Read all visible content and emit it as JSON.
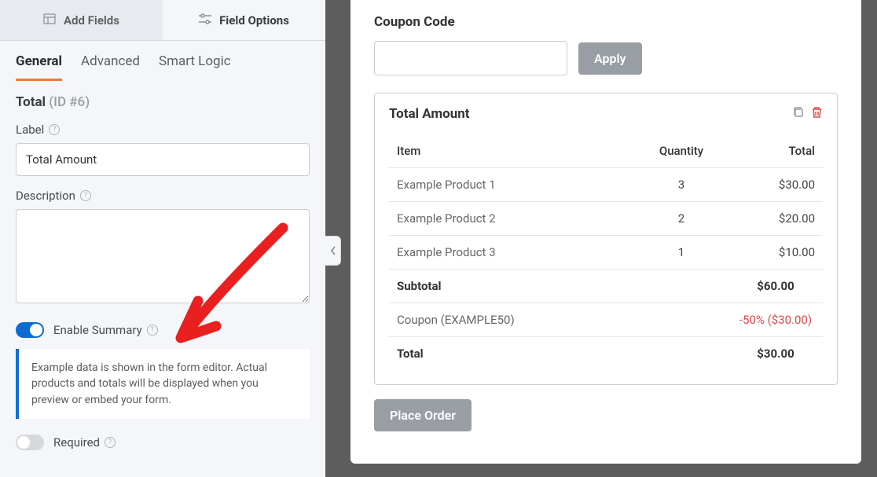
{
  "top_tabs": {
    "add_fields": "Add Fields",
    "field_options": "Field Options"
  },
  "sub_tabs": {
    "general": "General",
    "advanced": "Advanced",
    "smart_logic": "Smart Logic"
  },
  "field": {
    "name": "Total",
    "id_label": "(ID #6)",
    "label_caption": "Label",
    "label_value": "Total Amount",
    "description_caption": "Description",
    "enable_summary_label": "Enable Summary",
    "info_text": "Example data is shown in the form editor. Actual products and totals will be displayed when you preview or embed your form.",
    "required_label": "Required"
  },
  "preview": {
    "coupon_label": "Coupon Code",
    "apply_button": "Apply",
    "total_title": "Total Amount",
    "headers": {
      "item": "Item",
      "qty": "Quantity",
      "total": "Total"
    },
    "rows": [
      {
        "item": "Example Product 1",
        "qty": "3",
        "total": "$30.00"
      },
      {
        "item": "Example Product 2",
        "qty": "2",
        "total": "$20.00"
      },
      {
        "item": "Example Product 3",
        "qty": "1",
        "total": "$10.00"
      }
    ],
    "subtotal_label": "Subtotal",
    "subtotal_value": "$60.00",
    "coupon_row_label": "Coupon (EXAMPLE50)",
    "coupon_row_value": "-50% ($30.00)",
    "total_row_label": "Total",
    "total_row_value": "$30.00",
    "place_order": "Place Order"
  }
}
